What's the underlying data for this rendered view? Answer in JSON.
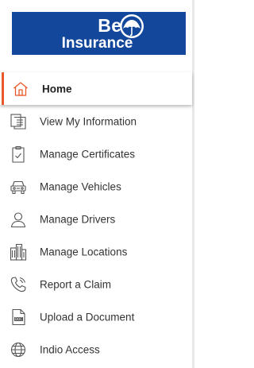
{
  "brand": {
    "line1": "Bell",
    "line2": "Insurance",
    "background": "#12479b"
  },
  "colors": {
    "active_indicator": "#e9572a",
    "icon_stroke": "#555555",
    "text": "#333333"
  },
  "nav": {
    "items": [
      {
        "label": "Home",
        "icon": "home-icon",
        "active": true
      },
      {
        "label": "View My Information",
        "icon": "document-icon",
        "active": false
      },
      {
        "label": "Manage Certificates",
        "icon": "clipboard-check-icon",
        "active": false
      },
      {
        "label": "Manage Vehicles",
        "icon": "car-icon",
        "active": false
      },
      {
        "label": "Manage Drivers",
        "icon": "person-icon",
        "active": false
      },
      {
        "label": "Manage Locations",
        "icon": "buildings-icon",
        "active": false
      },
      {
        "label": "Report a Claim",
        "icon": "phone-icon",
        "active": false
      },
      {
        "label": "Upload a Document",
        "icon": "doc-file-icon",
        "active": false
      },
      {
        "label": "Indio Access",
        "icon": "globe-icon",
        "active": false
      }
    ]
  }
}
